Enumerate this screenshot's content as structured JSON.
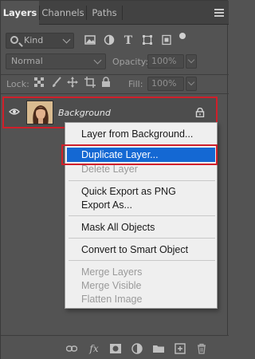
{
  "tabs": [
    {
      "label": "Layers",
      "active": true
    },
    {
      "label": "Channels",
      "active": false
    },
    {
      "label": "Paths",
      "active": false
    }
  ],
  "filter": {
    "kind_label": "Kind"
  },
  "blend": {
    "mode": "Normal",
    "opacity_label": "Opacity:",
    "opacity_value": "100%"
  },
  "lock": {
    "label": "Lock:",
    "fill_label": "Fill:",
    "fill_value": "100%"
  },
  "layer": {
    "name": "Background"
  },
  "context_menu": {
    "items": [
      {
        "label": "Layer from Background...",
        "enabled": true
      },
      {
        "label": "Duplicate Layer...",
        "enabled": true,
        "highlighted": true
      },
      {
        "label": "Delete Layer",
        "enabled": false
      },
      {
        "label": "Quick Export as PNG",
        "enabled": true
      },
      {
        "label": "Export As...",
        "enabled": true
      },
      {
        "label": "Mask All Objects",
        "enabled": true
      },
      {
        "label": "Convert to Smart Object",
        "enabled": true
      },
      {
        "label": "Merge Layers",
        "enabled": false
      },
      {
        "label": "Merge Visible",
        "enabled": false
      },
      {
        "label": "Flatten Image",
        "enabled": false
      }
    ]
  },
  "colors": {
    "highlight": "#1468d3",
    "annotation": "#d01f2a",
    "panel_bg": "#535353"
  }
}
